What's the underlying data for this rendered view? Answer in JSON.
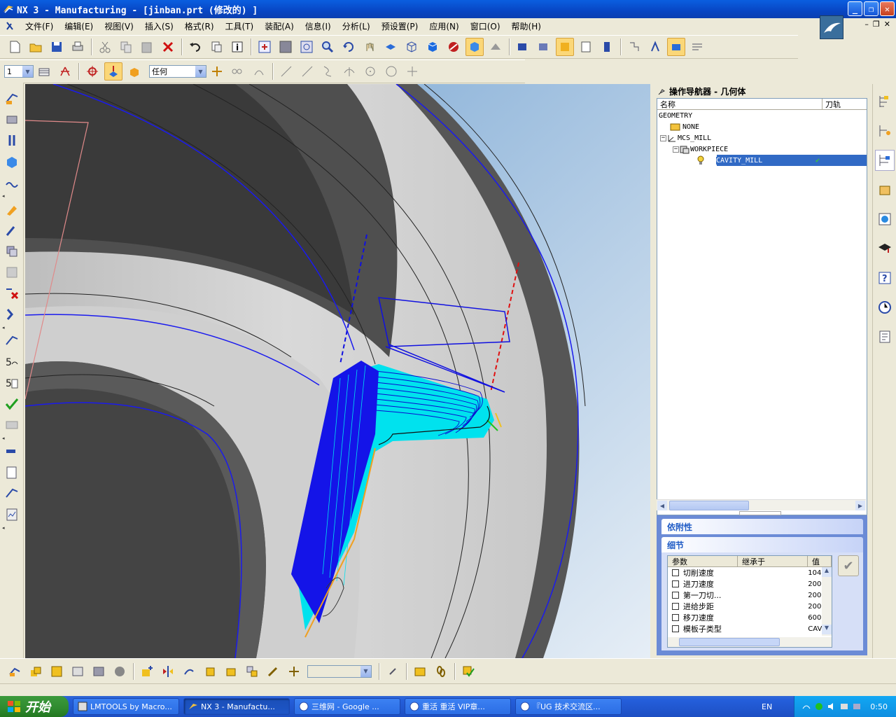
{
  "window": {
    "title": "NX 3 - Manufacturing - [jinban.prt  (修改的)  ]",
    "controls": [
      "minimize",
      "restore",
      "close"
    ]
  },
  "menubar": {
    "items": [
      "文件(F)",
      "编辑(E)",
      "视图(V)",
      "插入(S)",
      "格式(R)",
      "工具(T)",
      "装配(A)",
      "信息(I)",
      "分析(L)",
      "预设置(P)",
      "应用(N)",
      "窗口(O)",
      "帮助(H)"
    ]
  },
  "toolbar2": {
    "layer_select": "1",
    "filter_select": "任何"
  },
  "navigator": {
    "title": "操作导航器 - 几何体",
    "columns": [
      "名称",
      "刀轨"
    ],
    "tree": [
      {
        "label": "GEOMETRY",
        "indent": 0
      },
      {
        "label": "NONE",
        "indent": 1
      },
      {
        "label": "MCS_MILL",
        "indent": 1
      },
      {
        "label": "WORKPIECE",
        "indent": 2
      },
      {
        "label": "CAVITY_MILL",
        "indent": 3,
        "selected": true,
        "status": "✔"
      }
    ]
  },
  "details_panel": {
    "dependency_title": "依附性",
    "details_title": "细节",
    "columns": [
      "参数",
      "继承于",
      "值"
    ],
    "params": [
      {
        "name": "切削速度",
        "value": "104"
      },
      {
        "name": "进刀速度",
        "value": "200"
      },
      {
        "name": "第一刀切...",
        "value": "200"
      },
      {
        "name": "进给步距",
        "value": "200"
      },
      {
        "name": "移刀速度",
        "value": "600"
      },
      {
        "name": "模板子类型",
        "value": "CAV"
      }
    ]
  },
  "taskbar": {
    "start_label": "开始",
    "tasks": [
      {
        "label": "LMTOOLS by Macro..."
      },
      {
        "label": "NX 3 - Manufactu...",
        "active": true
      },
      {
        "label": "三维网 - Google ..."
      },
      {
        "label": "重活 重活 VIP章..."
      },
      {
        "label": "『UG 技术交流区..."
      }
    ],
    "language": "EN",
    "clock": "0:50"
  },
  "colors": {
    "titlebar": "#0a5fe0",
    "toolpath_blue": "#1010e0",
    "toolpath_cyan": "#00e5f0",
    "highlight": "#316ac5"
  }
}
